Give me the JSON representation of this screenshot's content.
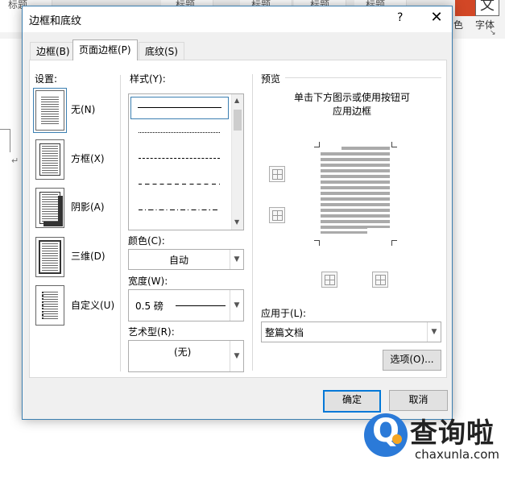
{
  "background": {
    "ribbon_styles": [
      "标题",
      "标题",
      "标题",
      "标题",
      "标题"
    ],
    "font_group_label": "字体",
    "font_icon_glyph": "文",
    "color_group_label": "色",
    "ribbon_arrow": "↘",
    "return_mark": "↵"
  },
  "dialog": {
    "title": "边框和底纹",
    "help": "?",
    "close": "✕",
    "tabs": [
      {
        "label": "边框(B)",
        "active": false
      },
      {
        "label": "页面边框(P)",
        "active": true
      },
      {
        "label": "底纹(S)",
        "active": false
      }
    ],
    "settings": {
      "label": "设置:",
      "items": [
        {
          "label": "无(N)",
          "selected": true
        },
        {
          "label": "方框(X)",
          "selected": false
        },
        {
          "label": "阴影(A)",
          "selected": false
        },
        {
          "label": "三维(D)",
          "selected": false
        },
        {
          "label": "自定义(U)",
          "selected": false
        }
      ]
    },
    "style": {
      "label": "样式(Y):",
      "options": [
        "solid",
        "dotted",
        "small-dash",
        "dash",
        "dash-dot"
      ]
    },
    "color": {
      "label": "颜色(C):",
      "value": "自动"
    },
    "width": {
      "label": "宽度(W):",
      "value": "0.5 磅"
    },
    "art": {
      "label": "艺术型(R):",
      "value": "(无)"
    },
    "preview": {
      "label": "预览",
      "hint_line1": "单击下方图示或使用按钮可",
      "hint_line2": "应用边框"
    },
    "apply_to": {
      "label": "应用于(L):",
      "value": "整篇文档"
    },
    "options_button": "选项(O)...",
    "ok_button": "确定",
    "cancel_button": "取消",
    "scroll_up": "▲",
    "scroll_down": "▼",
    "dropdown_arrow": "▼"
  },
  "watermark": {
    "name": "查询啦",
    "domain": "chaxunla.com",
    "logo_glyph": "Q",
    "colors": {
      "blue": "#2b7ad8",
      "orange": "#f5a623"
    }
  }
}
